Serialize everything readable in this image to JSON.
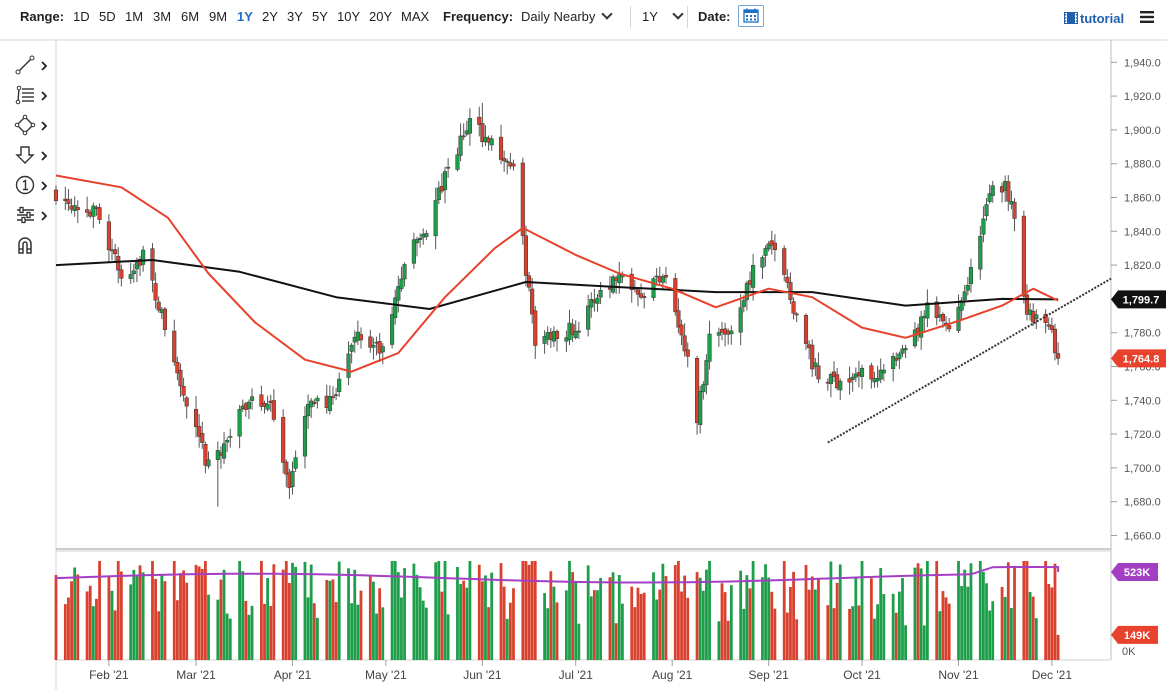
{
  "toolbar": {
    "range_label": "Range:",
    "ranges": [
      "1D",
      "5D",
      "1M",
      "3M",
      "6M",
      "9M",
      "1Y",
      "2Y",
      "3Y",
      "5Y",
      "10Y",
      "20Y",
      "MAX"
    ],
    "active_range": "1Y",
    "frequency_label": "Frequency:",
    "frequency_value": "Daily Nearby",
    "period_value": "1Y",
    "date_label": "Date:",
    "tutorial_label": "tutorial"
  },
  "tools": [
    "line-draw-tool",
    "fibonacci-tool",
    "shape-tool",
    "arrow-tool",
    "number-tool",
    "settings-tool",
    "magnet-tool"
  ],
  "colors": {
    "up": "#1e9e4a",
    "down": "#d9412f",
    "ma_short": "#e8412c",
    "ma_long": "#111111",
    "volume_ma": "#a43fc4",
    "trend": "#333333",
    "accent": "#1f6fc5"
  },
  "chart_data": {
    "type": "candlestick",
    "y_ticks": [
      "1,940.0",
      "1,920.0",
      "1,900.0",
      "1,880.0",
      "1,860.0",
      "1,840.0",
      "1,820.0",
      "1,800.0",
      "1,780.0",
      "1,760.0",
      "1,740.0",
      "1,720.0",
      "1,700.0",
      "1,680.0",
      "1,660.0"
    ],
    "ylim": [
      1652,
      1952
    ],
    "x_ticks": [
      "Feb '21",
      "Mar '21",
      "Apr '21",
      "May '21",
      "Jun '21",
      "Jul '21",
      "Aug '21",
      "Sep '21",
      "Oct '21",
      "Nov '21",
      "Dec '21"
    ],
    "x_range": [
      "2021-01-15",
      "2021-12-20"
    ],
    "last_price_label": "1,764.8",
    "ma_label": "1,799.7",
    "last_price": 1764.8,
    "ma_value": 1799.7,
    "price_path": [
      [
        "2021-01-15",
        1863
      ],
      [
        "2021-01-22",
        1856
      ],
      [
        "2021-01-29",
        1849
      ],
      [
        "2021-02-05",
        1812
      ],
      [
        "2021-02-12",
        1826
      ],
      [
        "2021-02-19",
        1783
      ],
      [
        "2021-02-26",
        1735
      ],
      [
        "2021-03-05",
        1700
      ],
      [
        "2021-03-12",
        1720
      ],
      [
        "2021-03-19",
        1744
      ],
      [
        "2021-03-26",
        1732
      ],
      [
        "2021-03-31",
        1690
      ],
      [
        "2021-04-07",
        1742
      ],
      [
        "2021-04-14",
        1737
      ],
      [
        "2021-04-21",
        1780
      ],
      [
        "2021-04-30",
        1768
      ],
      [
        "2021-05-07",
        1822
      ],
      [
        "2021-05-14",
        1842
      ],
      [
        "2021-05-21",
        1876
      ],
      [
        "2021-05-28",
        1905
      ],
      [
        "2021-06-04",
        1892
      ],
      [
        "2021-06-11",
        1877
      ],
      [
        "2021-06-18",
        1774
      ],
      [
        "2021-06-25",
        1781
      ],
      [
        "2021-07-02",
        1783
      ],
      [
        "2021-07-09",
        1806
      ],
      [
        "2021-07-16",
        1815
      ],
      [
        "2021-07-23",
        1804
      ],
      [
        "2021-07-30",
        1817
      ],
      [
        "2021-08-06",
        1763
      ],
      [
        "2021-08-09",
        1730
      ],
      [
        "2021-08-13",
        1778
      ],
      [
        "2021-08-20",
        1782
      ],
      [
        "2021-08-27",
        1817
      ],
      [
        "2021-09-03",
        1833
      ],
      [
        "2021-09-10",
        1790
      ],
      [
        "2021-09-17",
        1752
      ],
      [
        "2021-09-24",
        1752
      ],
      [
        "2021-09-30",
        1755
      ],
      [
        "2021-10-08",
        1757
      ],
      [
        "2021-10-15",
        1767
      ],
      [
        "2021-10-22",
        1793
      ],
      [
        "2021-10-29",
        1783
      ],
      [
        "2021-11-05",
        1816
      ],
      [
        "2021-11-12",
        1868
      ],
      [
        "2021-11-16",
        1867
      ],
      [
        "2021-11-19",
        1851
      ],
      [
        "2021-11-23",
        1791
      ],
      [
        "2021-11-26",
        1788
      ],
      [
        "2021-12-01",
        1780
      ],
      [
        "2021-12-03",
        1764.8
      ]
    ],
    "price_min": {
      "date": "2021-03-08",
      "value": 1677
    },
    "price_max": {
      "date": "2021-06-01",
      "value": 1916
    },
    "ma_short_path": [
      [
        "2021-01-15",
        1873
      ],
      [
        "2021-02-05",
        1866
      ],
      [
        "2021-02-20",
        1848
      ],
      [
        "2021-03-05",
        1815
      ],
      [
        "2021-03-20",
        1786
      ],
      [
        "2021-04-05",
        1764
      ],
      [
        "2021-04-20",
        1757
      ],
      [
        "2021-05-05",
        1768
      ],
      [
        "2021-05-20",
        1801
      ],
      [
        "2021-06-05",
        1830
      ],
      [
        "2021-06-14",
        1842
      ],
      [
        "2021-07-01",
        1826
      ],
      [
        "2021-07-15",
        1815
      ],
      [
        "2021-08-01",
        1806
      ],
      [
        "2021-08-15",
        1795
      ],
      [
        "2021-09-01",
        1806
      ],
      [
        "2021-09-15",
        1801
      ],
      [
        "2021-10-01",
        1783
      ],
      [
        "2021-10-15",
        1777
      ],
      [
        "2021-11-01",
        1787
      ],
      [
        "2021-11-15",
        1796
      ],
      [
        "2021-11-25",
        1806
      ],
      [
        "2021-12-03",
        1799
      ]
    ],
    "ma_long_path": [
      [
        "2021-01-15",
        1820
      ],
      [
        "2021-02-15",
        1823
      ],
      [
        "2021-03-15",
        1816
      ],
      [
        "2021-04-15",
        1801
      ],
      [
        "2021-05-15",
        1794
      ],
      [
        "2021-06-15",
        1810
      ],
      [
        "2021-07-15",
        1807
      ],
      [
        "2021-08-15",
        1804
      ],
      [
        "2021-09-15",
        1804
      ],
      [
        "2021-10-15",
        1796
      ],
      [
        "2021-11-15",
        1800
      ],
      [
        "2021-12-03",
        1799.7
      ]
    ],
    "trendline": [
      [
        "2021-09-20",
        1715
      ],
      [
        "2021-12-20",
        1812
      ]
    ],
    "volume": {
      "labels": {
        "ma": "523K",
        "last": "149K",
        "zero": "0K"
      },
      "ma_value": 523000,
      "last_value": 149000,
      "max": 600000
    }
  }
}
